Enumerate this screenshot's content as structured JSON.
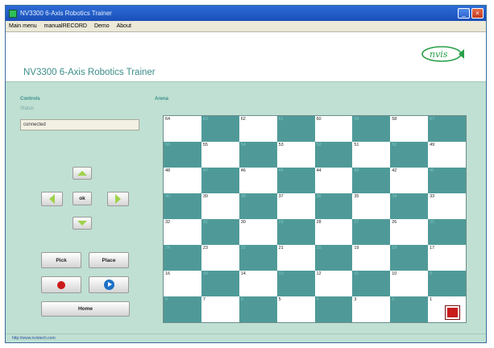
{
  "window": {
    "title": "NV3300 6-Axis Robotics Trainer",
    "controls": {
      "minimize": "_",
      "close": "×"
    }
  },
  "menu": [
    "Main menu",
    "manualRECORD",
    "Demo",
    "About"
  ],
  "header": {
    "app_title": "NV3300 6-Axis Robotics Trainer",
    "logo_text": "nvis",
    "logo_color": "#2aa04a"
  },
  "controls": {
    "heading": "Controls",
    "status_label": "Status",
    "status_value": "connected",
    "ok_label": "ok",
    "pick_label": "Pick",
    "place_label": "Place",
    "home_label": "Home"
  },
  "arena": {
    "heading": "Arena",
    "dark_color": "#4f9a98",
    "light_color": "#ffffff",
    "marker_square": 1,
    "marker_color": "#c81c1c",
    "rows": [
      [
        64,
        63,
        62,
        61,
        60,
        59,
        58,
        57
      ],
      [
        56,
        55,
        54,
        53,
        52,
        51,
        50,
        49
      ],
      [
        48,
        47,
        46,
        45,
        44,
        43,
        42,
        41
      ],
      [
        40,
        39,
        38,
        37,
        36,
        35,
        34,
        33
      ],
      [
        32,
        31,
        30,
        29,
        28,
        27,
        26,
        25
      ],
      [
        24,
        23,
        22,
        21,
        20,
        19,
        18,
        17
      ],
      [
        16,
        15,
        14,
        13,
        12,
        11,
        10,
        9
      ],
      [
        8,
        7,
        6,
        5,
        4,
        3,
        2,
        1
      ]
    ]
  },
  "statusbar": {
    "link": "http://www.nvistech.com"
  }
}
